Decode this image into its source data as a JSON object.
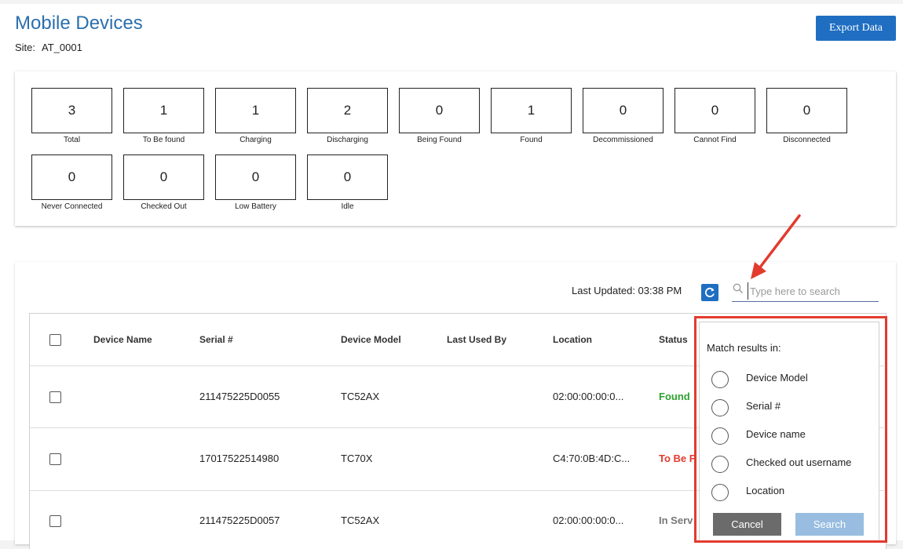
{
  "header": {
    "title": "Mobile Devices",
    "site_label": "Site:",
    "site_value": "AT_0001",
    "export_label": "Export Data"
  },
  "stats": [
    {
      "value": "3",
      "label": "Total"
    },
    {
      "value": "1",
      "label": "To Be found"
    },
    {
      "value": "1",
      "label": "Charging"
    },
    {
      "value": "2",
      "label": "Discharging"
    },
    {
      "value": "0",
      "label": "Being Found"
    },
    {
      "value": "1",
      "label": "Found"
    },
    {
      "value": "0",
      "label": "Decommissioned"
    },
    {
      "value": "0",
      "label": "Cannot Find"
    },
    {
      "value": "0",
      "label": "Disconnected"
    },
    {
      "value": "0",
      "label": "Never Connected"
    },
    {
      "value": "0",
      "label": "Checked Out"
    },
    {
      "value": "0",
      "label": "Low Battery"
    },
    {
      "value": "0",
      "label": "Idle"
    }
  ],
  "toolbar": {
    "last_updated": "Last Updated: 03:38 PM",
    "search_placeholder": "Type here to search",
    "refresh_icon": "refresh-icon",
    "search_icon": "search-icon"
  },
  "table": {
    "columns": [
      "Device Name",
      "Serial #",
      "Device Model",
      "Last Used By",
      "Location",
      "Status"
    ],
    "rows": [
      {
        "device_name": "",
        "serial": "211475225D0055",
        "model": "TC52AX",
        "last_used_by": "",
        "location": "02:00:00:00:0...",
        "status": "Found",
        "status_color": "#2ea12e"
      },
      {
        "device_name": "",
        "serial": "17017522514980",
        "model": "TC70X",
        "last_used_by": "",
        "location": "C4:70:0B:4D:C...",
        "status": "To Be F",
        "status_color": "#e23b2e"
      },
      {
        "device_name": "",
        "serial": "211475225D0057",
        "model": "TC52AX",
        "last_used_by": "",
        "location": "02:00:00:00:0...",
        "status": "In Serv",
        "status_color": "#777777"
      }
    ]
  },
  "search_panel": {
    "title": "Match results in:",
    "options": [
      "Device Model",
      "Serial #",
      "Device name",
      "Checked out username",
      "Location"
    ],
    "cancel_label": "Cancel",
    "search_label": "Search"
  },
  "colors": {
    "title": "#2b6fae",
    "primary": "#1f6ec2",
    "highlight": "#e23b2e"
  }
}
